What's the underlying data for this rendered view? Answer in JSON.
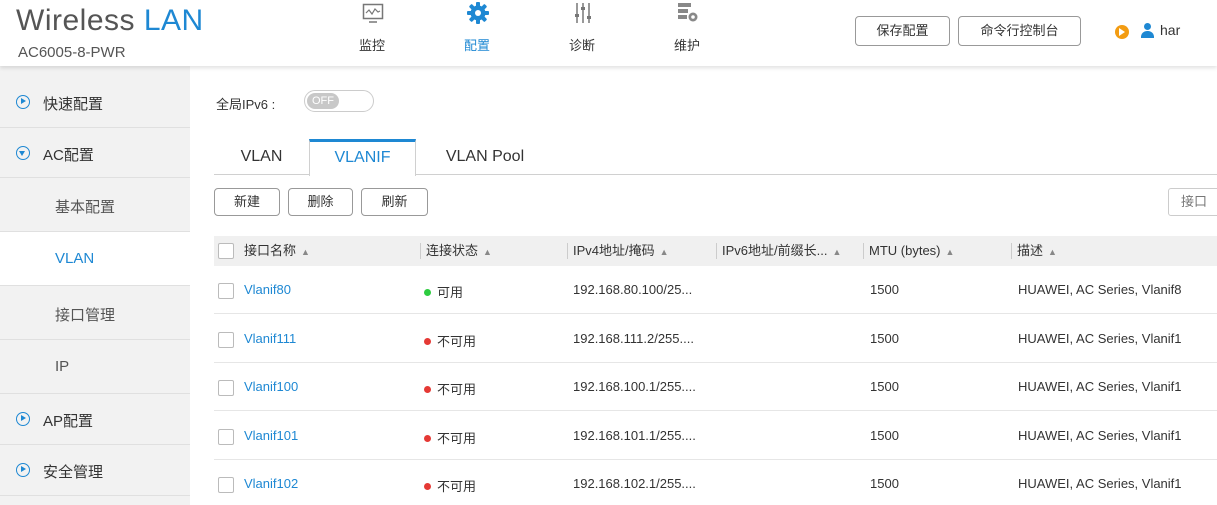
{
  "brand": {
    "title_part1": "Wireless",
    "title_part2": "LAN",
    "model": "AC6005-8-PWR"
  },
  "nav": [
    {
      "label": "监控",
      "icon": "monitor-icon"
    },
    {
      "label": "配置",
      "icon": "gear-icon",
      "active": true
    },
    {
      "label": "诊断",
      "icon": "sliders-icon"
    },
    {
      "label": "维护",
      "icon": "maintenance-icon"
    }
  ],
  "header_buttons": {
    "save": "保存配置",
    "console": "命令行控制台"
  },
  "user": {
    "name": "har"
  },
  "sidebar": {
    "items": [
      {
        "label": "快速配置",
        "icon": "circle-arrow-right-icon"
      },
      {
        "label": "AC配置",
        "icon": "circle-arrow-down-icon"
      },
      {
        "label": "基本配置"
      },
      {
        "label": "VLAN",
        "active": true
      },
      {
        "label": "接口管理"
      },
      {
        "label": "IP"
      },
      {
        "label": "AP配置",
        "icon": "circle-arrow-right-icon"
      },
      {
        "label": "安全管理",
        "icon": "circle-arrow-right-icon"
      }
    ]
  },
  "ipv6": {
    "label": "全局IPv6 :",
    "toggle": "OFF"
  },
  "tabs": [
    {
      "label": "VLAN"
    },
    {
      "label": "VLANIF",
      "active": true
    },
    {
      "label": "VLAN Pool"
    }
  ],
  "toolbar": {
    "new": "新建",
    "delete": "删除",
    "refresh": "刷新",
    "search_placeholder": "接口"
  },
  "table": {
    "columns": [
      "接口名称",
      "连接状态",
      "IPv4地址/掩码",
      "IPv6地址/前缀长...",
      "MTU (bytes)",
      "描述"
    ],
    "rows": [
      {
        "name": "Vlanif80",
        "status": "可用",
        "status_color": "#2ecc40",
        "ipv4": "192.168.80.100/25...",
        "ipv6": "",
        "mtu": "1500",
        "desc": "HUAWEI, AC Series, Vlanif8"
      },
      {
        "name": "Vlanif111",
        "status": "不可用",
        "status_color": "#e53935",
        "ipv4": "192.168.111.2/255....",
        "ipv6": "",
        "mtu": "1500",
        "desc": "HUAWEI, AC Series, Vlanif1"
      },
      {
        "name": "Vlanif100",
        "status": "不可用",
        "status_color": "#e53935",
        "ipv4": "192.168.100.1/255....",
        "ipv6": "",
        "mtu": "1500",
        "desc": "HUAWEI, AC Series, Vlanif1"
      },
      {
        "name": "Vlanif101",
        "status": "不可用",
        "status_color": "#e53935",
        "ipv4": "192.168.101.1/255....",
        "ipv6": "",
        "mtu": "1500",
        "desc": "HUAWEI, AC Series, Vlanif1"
      },
      {
        "name": "Vlanif102",
        "status": "不可用",
        "status_color": "#e53935",
        "ipv4": "192.168.102.1/255....",
        "ipv6": "",
        "mtu": "1500",
        "desc": "HUAWEI, AC Series, Vlanif1"
      }
    ]
  }
}
